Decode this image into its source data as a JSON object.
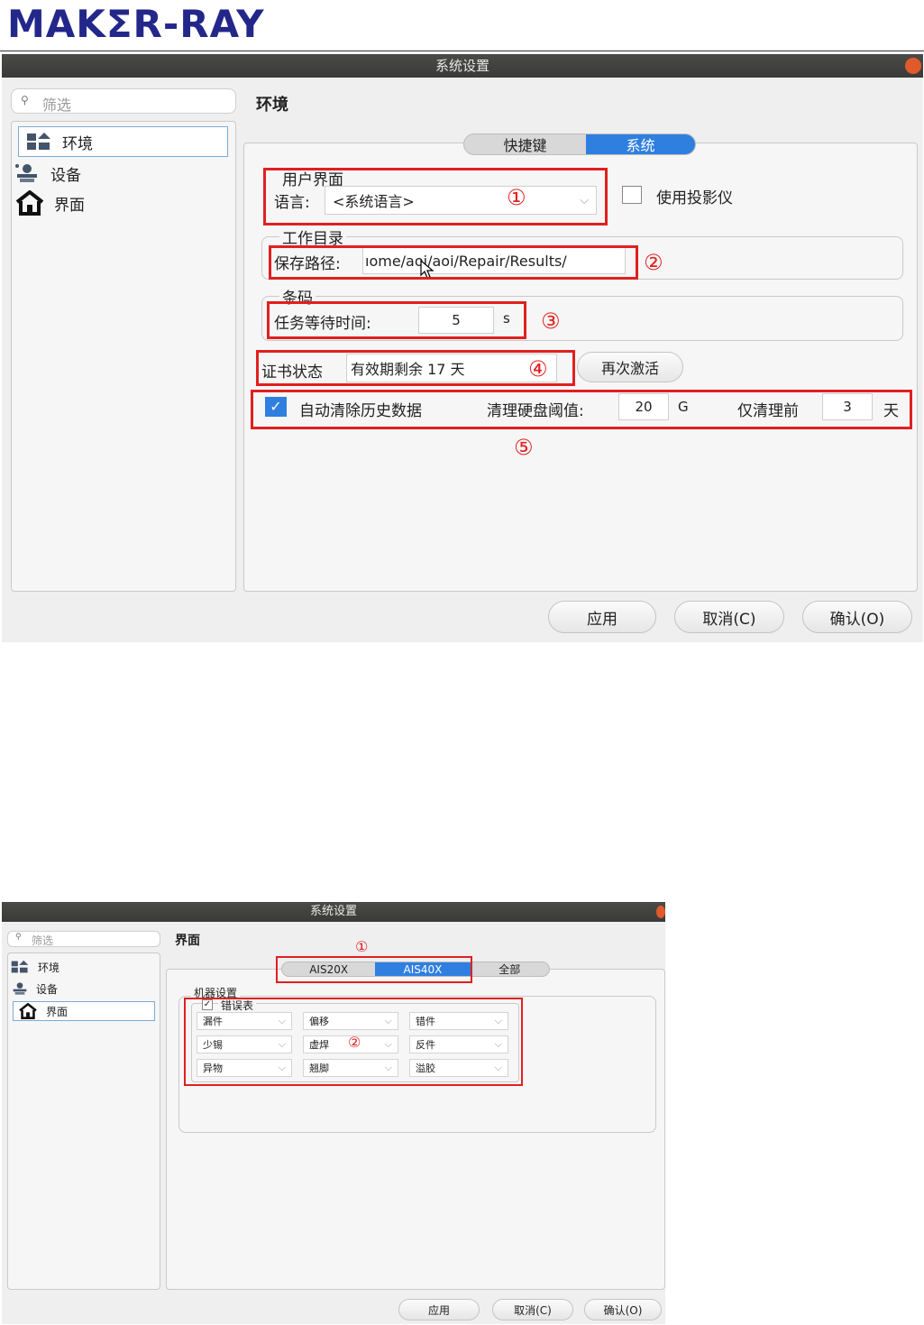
{
  "logo": "MAKΣR-RAY",
  "dialog1": {
    "title": "系统设置",
    "search_placeholder": "筛选",
    "nav": [
      {
        "label": "环境",
        "icon": "environment-icon"
      },
      {
        "label": "设备",
        "icon": "device-icon"
      },
      {
        "label": "界面",
        "icon": "home-icon"
      }
    ],
    "heading": "环境",
    "tabs": [
      "快捷键",
      "系统"
    ],
    "user_interface": {
      "group": "用户界面",
      "language_label": "语言:",
      "language_value": "<系统语言>",
      "marker": "①",
      "projector_label": "使用投影仪"
    },
    "workdir": {
      "group": "工作目录",
      "path_label": "保存路径:",
      "path_value": "ıome/aoi/aoi/Repair/Results/",
      "marker": "②"
    },
    "barcode": {
      "group": "条码",
      "wait_label": "任务等待时间:",
      "wait_value": "5",
      "wait_unit": "s",
      "marker": "③"
    },
    "certificate": {
      "label": "证书状态",
      "value": "有效期剩余 17 天",
      "marker": "④",
      "button": "再次激活"
    },
    "cleanup": {
      "checkbox_label": "自动清除历史数据",
      "threshold_label": "清理硬盘阈值:",
      "threshold_value": "20",
      "threshold_unit": "G",
      "keep_label": "仅清理前",
      "keep_value": "3",
      "keep_unit": "天",
      "marker": "⑤"
    },
    "buttons": {
      "apply": "应用",
      "cancel": "取消(C)",
      "ok": "确认(O)"
    }
  },
  "dialog2": {
    "title": "系统设置",
    "search_placeholder": "筛选",
    "nav": [
      {
        "label": "环境",
        "icon": "environment-icon"
      },
      {
        "label": "设备",
        "icon": "device-icon"
      },
      {
        "label": "界面",
        "icon": "home-icon"
      }
    ],
    "heading": "界面",
    "tabs": [
      "AIS20X",
      "AIS40X",
      "全部"
    ],
    "marker1": "①",
    "machine_group": "机器设置",
    "error_table_label": "错误表",
    "combos": [
      "漏件",
      "偏移",
      "错件",
      "少锡",
      "虚焊",
      "反件",
      "异物",
      "翘脚",
      "溢胶"
    ],
    "marker2": "②",
    "buttons": {
      "apply": "应用",
      "cancel": "取消(C)",
      "ok": "确认(O)"
    }
  }
}
